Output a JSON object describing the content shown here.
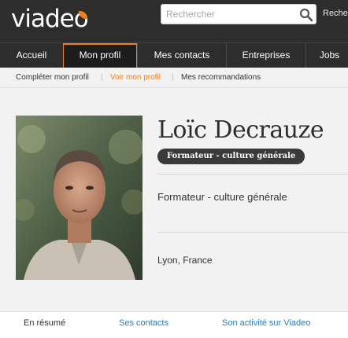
{
  "brand": {
    "logo_text": "viadeo",
    "accent_color": "#f07f1d"
  },
  "search": {
    "placeholder": "Rechercher",
    "value": "",
    "link_label": "Reche"
  },
  "nav": {
    "items": [
      {
        "label": "Accueil"
      },
      {
        "label": "Mon profil",
        "active": true
      },
      {
        "label": "Mes contacts"
      },
      {
        "label": "Entreprises"
      },
      {
        "label": "Jobs"
      }
    ]
  },
  "subnav": {
    "items": [
      {
        "label": "Compléter mon profil"
      },
      {
        "label": "Voir mon profil",
        "active": true
      },
      {
        "label": "Mes recommandations"
      }
    ],
    "separator": "|"
  },
  "profile": {
    "name": "Loïc Decrauze",
    "headline_badge": "Formateur - culture générale",
    "headline": "Formateur - culture générale",
    "location": "Lyon, France"
  },
  "tabs": [
    {
      "label": "En résumé"
    },
    {
      "label": "Ses contacts"
    },
    {
      "label": "Son activité sur Viadeo"
    }
  ]
}
